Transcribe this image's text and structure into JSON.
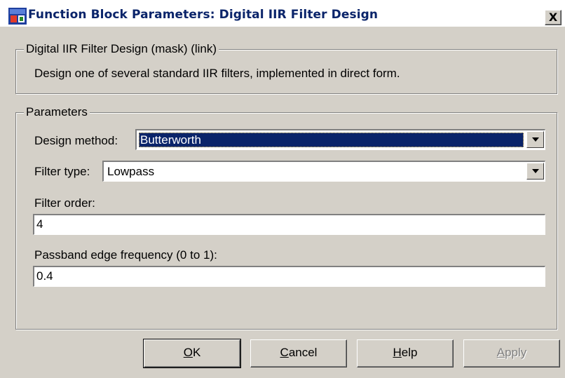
{
  "window": {
    "title": "Function Block Parameters: Digital IIR Filter Design",
    "close_glyph": "X",
    "icon": "simulink-block-icon"
  },
  "mask_group": {
    "legend": "Digital IIR Filter Design (mask) (link)",
    "description": "Design one of several standard IIR filters, implemented in direct form."
  },
  "params_group": {
    "legend": "Parameters",
    "design_method": {
      "label": "Design method:",
      "value": "Butterworth"
    },
    "filter_type": {
      "label": "Filter type:",
      "value": "Lowpass"
    },
    "filter_order": {
      "label": "Filter order:",
      "value": "4"
    },
    "passband": {
      "label": "Passband edge frequency (0 to 1):",
      "value": "0.4"
    }
  },
  "buttons": {
    "ok": {
      "mnemonic": "O",
      "rest": "K"
    },
    "cancel": {
      "mnemonic": "C",
      "rest": "ancel"
    },
    "help": {
      "mnemonic": "H",
      "rest": "elp"
    },
    "apply": {
      "mnemonic": "A",
      "rest": "pply"
    }
  },
  "colors": {
    "titlebar_text": "#0a246a",
    "selection": "#0a246a",
    "face": "#d4d0c8"
  }
}
